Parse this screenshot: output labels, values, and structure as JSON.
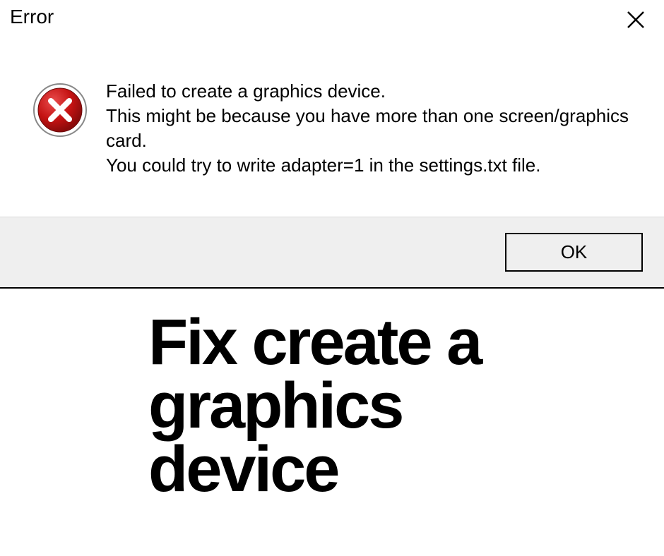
{
  "dialog": {
    "title": "Error",
    "message_line1": "Failed to create a graphics device.",
    "message_line2": "This might be because you have more than one screen/graphics card.",
    "message_line3": "You could try to write adapter=1 in the settings.txt file.",
    "ok_label": "OK"
  },
  "headline": "Fix create a graphics device"
}
